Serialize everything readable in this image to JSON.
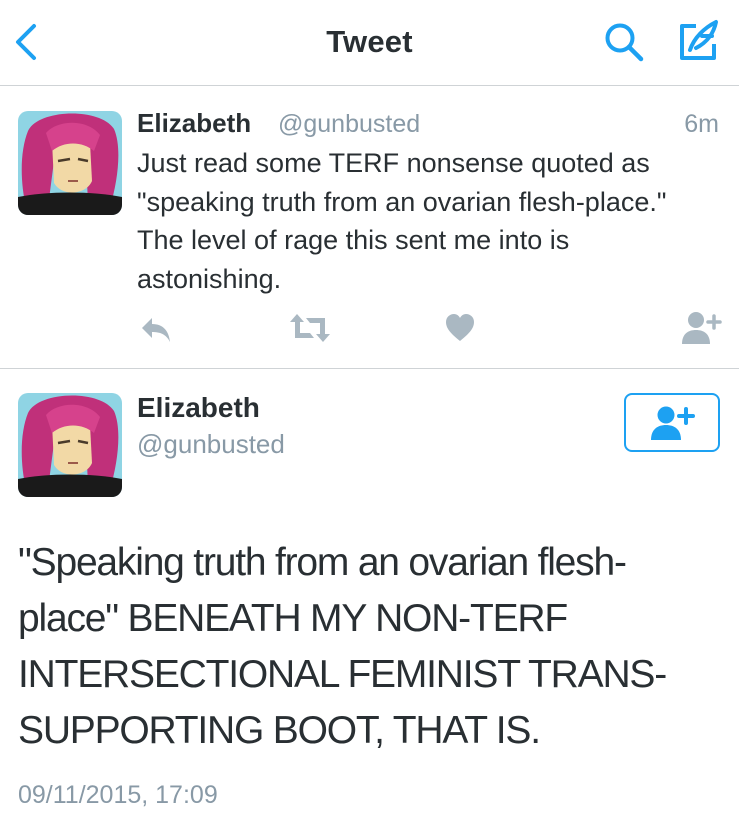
{
  "colors": {
    "accent": "#1da1f2",
    "text": "#292f33",
    "secondary": "#8899a6",
    "icon_gray": "#aab8c2",
    "divider": "#cfd3d6"
  },
  "navbar": {
    "title": "Tweet",
    "back_icon": "chevron-left-icon",
    "search_icon": "search-icon",
    "compose_icon": "compose-icon"
  },
  "reply_tweet": {
    "name": "Elizabeth",
    "handle": "@gunbusted",
    "time": "6m",
    "text": "Just read some TERF nonsense quoted as \"speaking truth from an ovarian flesh-place.\" The level of rage this sent me into is astonishing.",
    "actions": [
      "reply-icon",
      "retweet-icon",
      "like-icon",
      "follow-icon"
    ]
  },
  "main_tweet": {
    "name": "Elizabeth",
    "handle": "@gunbusted",
    "text": "\"Speaking truth from an ovarian flesh-place\" BENEATH MY NON-TERF INTERSECTIONAL FEMINIST TRANS-SUPPORTING BOOT, THAT IS.",
    "timestamp": "09/11/2015, 17:09",
    "follow_icon": "add-user-icon"
  }
}
